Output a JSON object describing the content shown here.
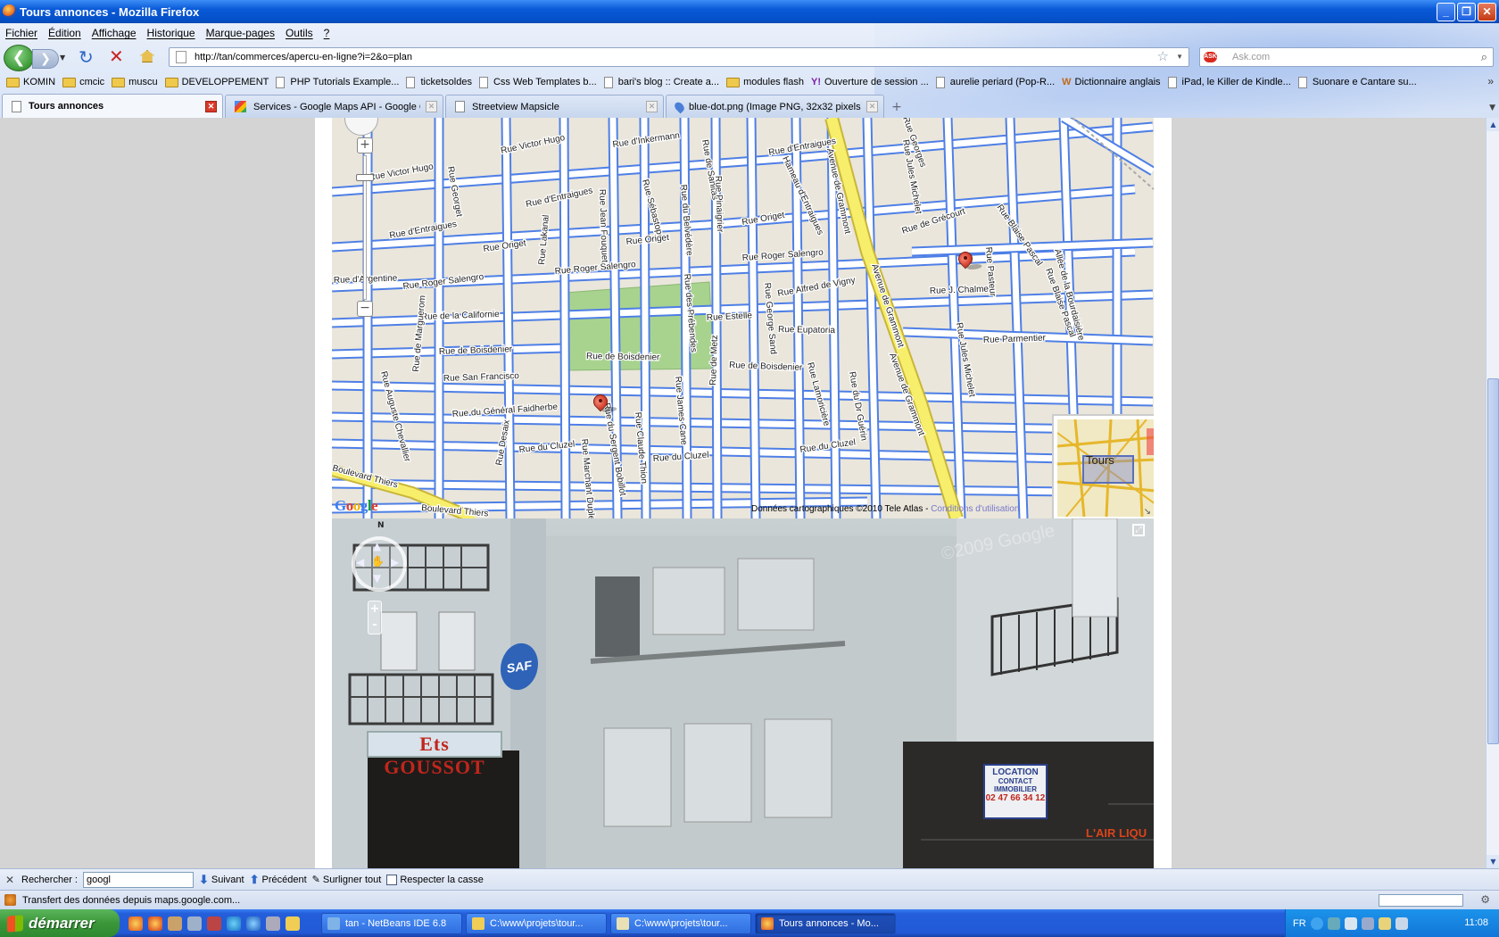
{
  "window": {
    "title": "Tours annonces - Mozilla Firefox",
    "buttons": {
      "minimize": "_",
      "maximize": "❐",
      "close": "✕"
    }
  },
  "menu": [
    "Fichier",
    "Édition",
    "Affichage",
    "Historique",
    "Marque-pages",
    "Outils",
    "?"
  ],
  "navigation": {
    "url": "http://tan/commerces/apercu-en-ligne?i=2&o=plan",
    "search_placeholder": "Ask.com",
    "search_engine_badge": "ASK"
  },
  "bookmarks": [
    {
      "label": "KOMIN",
      "type": "folder"
    },
    {
      "label": "cmcic",
      "type": "folder"
    },
    {
      "label": "muscu",
      "type": "folder"
    },
    {
      "label": "DEVELOPPEMENT",
      "type": "folder"
    },
    {
      "label": "PHP Tutorials Example...",
      "type": "page"
    },
    {
      "label": "ticketsoldes",
      "type": "page"
    },
    {
      "label": "Css Web Templates b...",
      "type": "page"
    },
    {
      "label": "bari's blog :: Create a...",
      "type": "page"
    },
    {
      "label": "modules flash",
      "type": "folder"
    },
    {
      "label": "Ouverture de session ...",
      "type": "yahoo"
    },
    {
      "label": "aurelie periard (Pop-R...",
      "type": "page"
    },
    {
      "label": "Dictionnaire anglais",
      "type": "wr"
    },
    {
      "label": "iPad, le Killer de Kindle...",
      "type": "page"
    },
    {
      "label": "Suonare e Cantare su...",
      "type": "page"
    }
  ],
  "tabs": [
    {
      "label": "Tours annonces",
      "active": true,
      "icon": "page"
    },
    {
      "label": "Services - Google Maps API - Google C...",
      "active": false,
      "icon": "google"
    },
    {
      "label": "Streetview Mapsicle",
      "active": false,
      "icon": "page"
    },
    {
      "label": "blue-dot.png (Image PNG, 32x32 pixels)",
      "active": false,
      "icon": "pin"
    }
  ],
  "map": {
    "streets": [
      "Rue Victor Hugo",
      "Rue Victor Hugo",
      "Rue d'Inkermann",
      "Rue Sébastopol",
      "Rue de Sanitas",
      "Rue d'Entraigues",
      "Rue d'Entraigues",
      "Rue d'Entraigues",
      "Rue Origet",
      "Rue Origet",
      "Rue Origet",
      "Rue Roger Salengro",
      "Rue Roger Salengro",
      "Rue Roger Salengro",
      "Rue de la Californie",
      "Rue de Boisdenier",
      "Rue de Boisdenier",
      "Rue de Boisdenier",
      "Rue San Francisco",
      "Rue du Général Faidherbe",
      "Rue du Cluzel",
      "Rue du Cluzel",
      "Rue du Cluzel",
      "Rue Estelle",
      "Rue Eupatoria",
      "Rue Alfred de Vigny",
      "Rue J. Chalmel",
      "Rue Parmentier",
      "Rue de Grécourt",
      "Avenue de Grammont",
      "Avenue de Grammont",
      "Avenue de Grammont",
      "Rue Jules Michelet",
      "Rue Jules Michelet",
      "Rue Blaise Pascal",
      "Rue Pasteur",
      "Rue de Marguerom",
      "Rue Auguste Chevallier",
      "Boulevard Thiers",
      "Rue Desaix",
      "Rue du Sergent Bobillot",
      "Rue Claude Thion",
      "Rue James Cane",
      "Rue de Metz",
      "Rue Lamoricière",
      "Rue du Dr Guérin",
      "Rue George Sand",
      "Rue des Prébendes",
      "Rue du Belvédère",
      "Rue Pinaigrier",
      "Rue Jean Fouquet",
      "Rue Lakanal",
      "Rue Georget",
      "Rue d'Argentine",
      "Hameau d'Entraigues",
      "Rue Blaise Pascal",
      "Allée de la Bourdaisière",
      "Rue Marchant Duplessis",
      "Boulevard Thiers",
      "Rue Georges"
    ],
    "copyright": "Données cartographiques ©2010 Tele Atlas - ",
    "terms": "Conditions d'utilisation",
    "overview_city": "Tours",
    "logo": "Google"
  },
  "streetview": {
    "north_label": "N",
    "zoom_in": "+",
    "zoom_out": "-",
    "watermark": "©2009 Google",
    "sign_shop": "Ets GOUSSOT",
    "sign_brand": "SAF",
    "sign_location_title": "LOCATION",
    "sign_location_sub": "CONTACT IMMOBILIER",
    "sign_location_phone": "02 47 66 34 12",
    "sign_store": "L'AIR LIQU"
  },
  "findbar": {
    "label": "Rechercher :",
    "value": "googl",
    "next": "Suivant",
    "previous": "Précédent",
    "highlight": "Surligner tout",
    "match_case": "Respecter la casse"
  },
  "status": {
    "text": "Transfert des données depuis maps.google.com..."
  },
  "taskbar": {
    "start": "démarrer",
    "tasks": [
      {
        "label": "tan - NetBeans IDE 6.8",
        "active": false
      },
      {
        "label": "C:\\www\\projets\\tour...",
        "active": false
      },
      {
        "label": "C:\\www\\projets\\tour...",
        "active": false
      },
      {
        "label": "Tours annonces - Mo...",
        "active": true
      }
    ],
    "lang": "FR",
    "clock": "11:08"
  },
  "colors": {
    "road_minor": "#ffffff",
    "road_outline": "#4e7fe6",
    "road_major": "#f7ef6b",
    "park": "#a8d38f",
    "block": "#eae6db",
    "pin": "#d23a27"
  }
}
